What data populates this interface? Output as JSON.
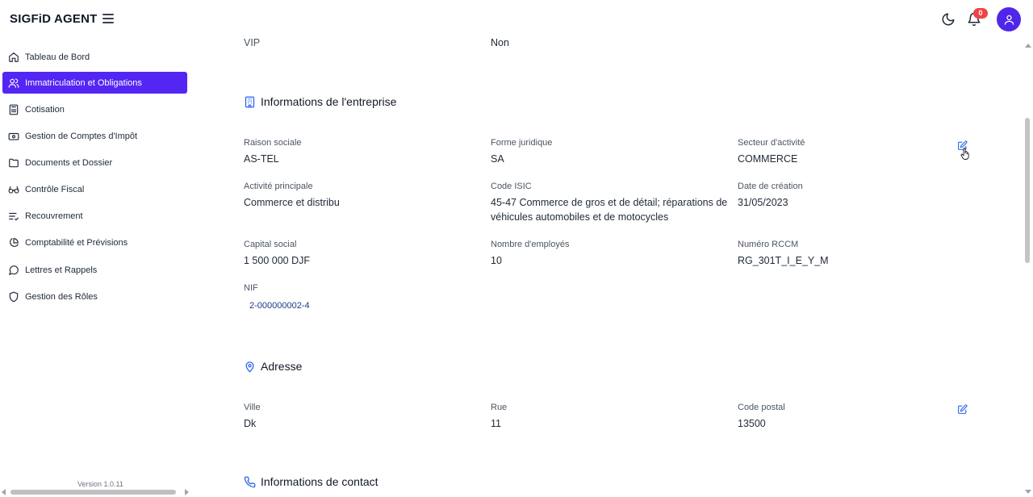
{
  "header": {
    "app_title": "SIGFiD AGENT",
    "notification_count": "0"
  },
  "sidebar": {
    "items": [
      {
        "label": "Tableau de Bord",
        "icon": "home-icon"
      },
      {
        "label": "Immatriculation et Obligations",
        "icon": "users-icon",
        "active": true
      },
      {
        "label": "Cotisation",
        "icon": "calculator-icon"
      },
      {
        "label": "Gestion de Comptes d'Impôt",
        "icon": "wallet-icon"
      },
      {
        "label": "Documents et Dossier",
        "icon": "folder-icon"
      },
      {
        "label": "Contrôle Fiscal",
        "icon": "glasses-icon"
      },
      {
        "label": "Recouvrement",
        "icon": "list-check-icon"
      },
      {
        "label": "Comptabilité et Prévisions",
        "icon": "pie-chart-icon"
      },
      {
        "label": "Lettres et Rappels",
        "icon": "message-icon"
      },
      {
        "label": "Gestion des Rôles",
        "icon": "shield-icon"
      }
    ],
    "version": "Version 1.0.11"
  },
  "top_row": {
    "vip_label": "VIP",
    "vip_value": "Non"
  },
  "entreprise": {
    "title": "Informations de l'entreprise",
    "raison_sociale_label": "Raison sociale",
    "raison_sociale_value": "AS-TEL",
    "forme_juridique_label": "Forme juridique",
    "forme_juridique_value": "SA",
    "secteur_label": "Secteur d'activité",
    "secteur_value": "COMMERCE",
    "activite_label": "Activité principale",
    "activite_value": "Commerce et distribu",
    "isic_label": "Code ISIC",
    "isic_value_line1": "45-47 Commerce de gros et de détail; réparations de",
    "isic_value_line2": "véhicules automobiles et de motocycles",
    "date_creation_label": "Date de création",
    "date_creation_value": "31/05/2023",
    "capital_label": "Capital social",
    "capital_value": "1 500 000 DJF",
    "employes_label": "Nombre d'employés",
    "employes_value": "10",
    "rccm_label": "Numéro RCCM",
    "rccm_value": "RG_301T_I_E_Y_M",
    "nif_label": "NIF",
    "nif_value": "2-000000002-4"
  },
  "adresse": {
    "title": "Adresse",
    "ville_label": "Ville",
    "ville_value": "Dk",
    "rue_label": "Rue",
    "rue_value": "11",
    "code_postal_label": "Code postal",
    "code_postal_value": "13500"
  },
  "contact": {
    "title": "Informations de contact"
  },
  "colors": {
    "accent": "#5426f4",
    "avatar": "#4f26ea",
    "badge": "#ef4444",
    "edit_icon": "#2563eb",
    "section_icon": "#2563eb"
  }
}
